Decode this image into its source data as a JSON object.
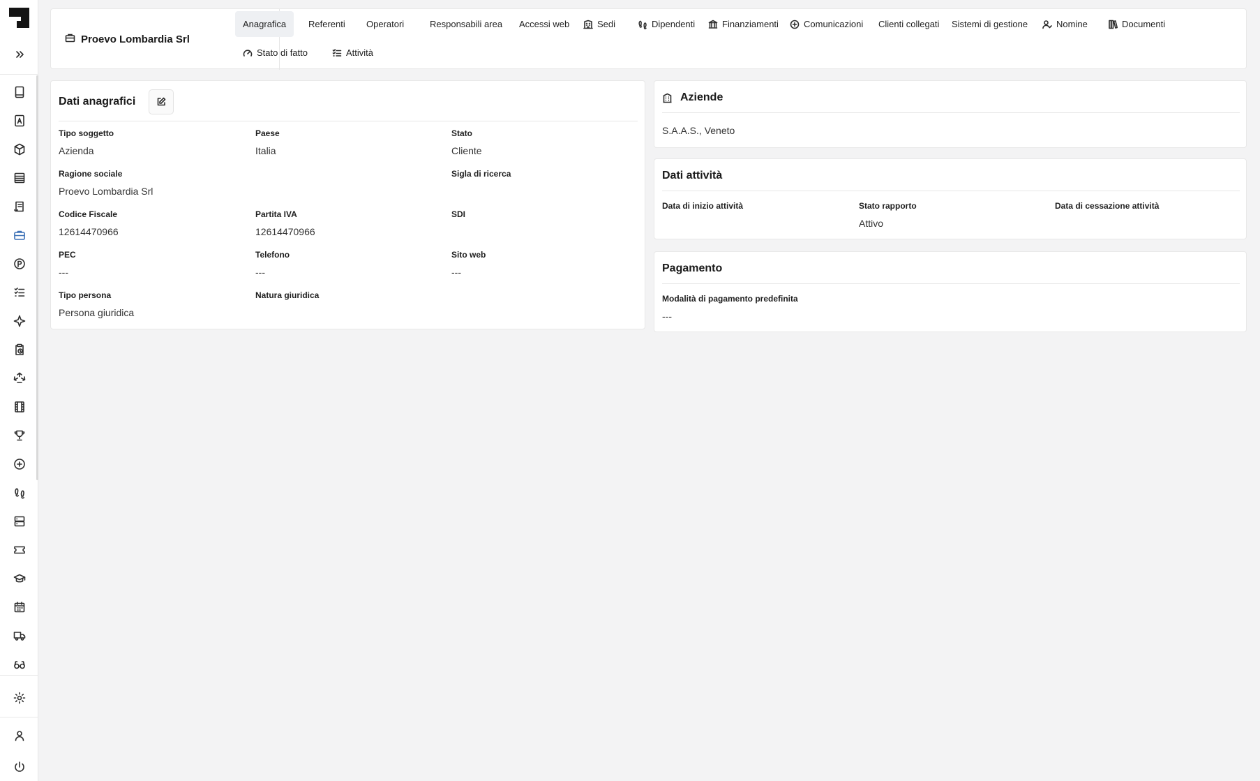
{
  "header": {
    "company_name": "Proevo Lombardia Srl",
    "tabs": [
      {
        "label": "Anagrafica",
        "icon": "none",
        "active": true
      },
      {
        "label": "Referenti",
        "icon": "none"
      },
      {
        "label": "Operatori",
        "icon": "none"
      },
      {
        "label": "Responsabili area",
        "icon": "none"
      },
      {
        "label": "Accessi web",
        "icon": "none"
      },
      {
        "label": "Sedi",
        "icon": "building-icon"
      },
      {
        "label": "Dipendenti",
        "icon": "footsteps-icon"
      },
      {
        "label": "Finanziamenti",
        "icon": "bank-icon"
      },
      {
        "label": "Comunicazioni",
        "icon": "plus-circle-icon"
      },
      {
        "label": "Clienti collegati",
        "icon": "none"
      },
      {
        "label": "Sistemi di gestione",
        "icon": "none"
      },
      {
        "label": "Nomine",
        "icon": "user-check-icon"
      },
      {
        "label": "Documenti",
        "icon": "books-icon"
      },
      {
        "label": "Stato di fatto",
        "icon": "gauge-icon"
      },
      {
        "label": "Attività",
        "icon": "list-check-icon"
      }
    ]
  },
  "dati_anagrafici": {
    "title": "Dati anagrafici",
    "fields": {
      "tipo_soggetto": {
        "label": "Tipo soggetto",
        "value": "Azienda"
      },
      "paese": {
        "label": "Paese",
        "value": "Italia"
      },
      "stato": {
        "label": "Stato",
        "value": "Cliente"
      },
      "ragione_sociale": {
        "label": "Ragione sociale",
        "value": "Proevo Lombardia Srl"
      },
      "sigla_ricerca": {
        "label": "Sigla di ricerca",
        "value": ""
      },
      "codice_fiscale": {
        "label": "Codice Fiscale",
        "value": "12614470966"
      },
      "partita_iva": {
        "label": "Partita IVA",
        "value": "12614470966"
      },
      "sdi": {
        "label": "SDI",
        "value": ""
      },
      "pec": {
        "label": "PEC",
        "value": "---"
      },
      "telefono": {
        "label": "Telefono",
        "value": "---"
      },
      "sito_web": {
        "label": "Sito web",
        "value": "---"
      },
      "tipo_persona": {
        "label": "Tipo persona",
        "value": "Persona giuridica"
      },
      "natura_giuridica": {
        "label": "Natura giuridica",
        "value": ""
      }
    }
  },
  "aziende": {
    "title": "Aziende",
    "value": "S.A.A.S., Veneto"
  },
  "dati_attivita": {
    "title": "Dati attività",
    "fields": {
      "data_inizio": {
        "label": "Data di inizio attività",
        "value": ""
      },
      "stato_rapporto": {
        "label": "Stato rapporto",
        "value": "Attivo"
      },
      "data_cessazione": {
        "label": "Data di cessazione attività",
        "value": ""
      }
    }
  },
  "pagamento": {
    "title": "Pagamento",
    "fields": {
      "modalita": {
        "label": "Modalità di pagamento predefinita",
        "value": "---"
      }
    }
  },
  "sidebar": {
    "icons": [
      "tablet-icon",
      "id-card-icon",
      "cube-icon",
      "table-icon",
      "receipt-icon",
      "briefcase-icon",
      "parking-icon",
      "list-check-icon",
      "sparkle-icon",
      "clipboard-clock-icon",
      "recycle-icon",
      "film-icon",
      "trophy-icon",
      "plus-circle-icon",
      "footsteps-icon",
      "server-icon",
      "ticket-icon",
      "graduation-cap-icon",
      "calendar-icon",
      "truck-icon",
      "glasses-icon",
      "gear-icon",
      "user-icon",
      "power-icon"
    ],
    "active": "briefcase-icon"
  },
  "colors": {
    "accent": "#3a6fb5",
    "background": "#f3f3f4",
    "card": "#ffffff"
  }
}
